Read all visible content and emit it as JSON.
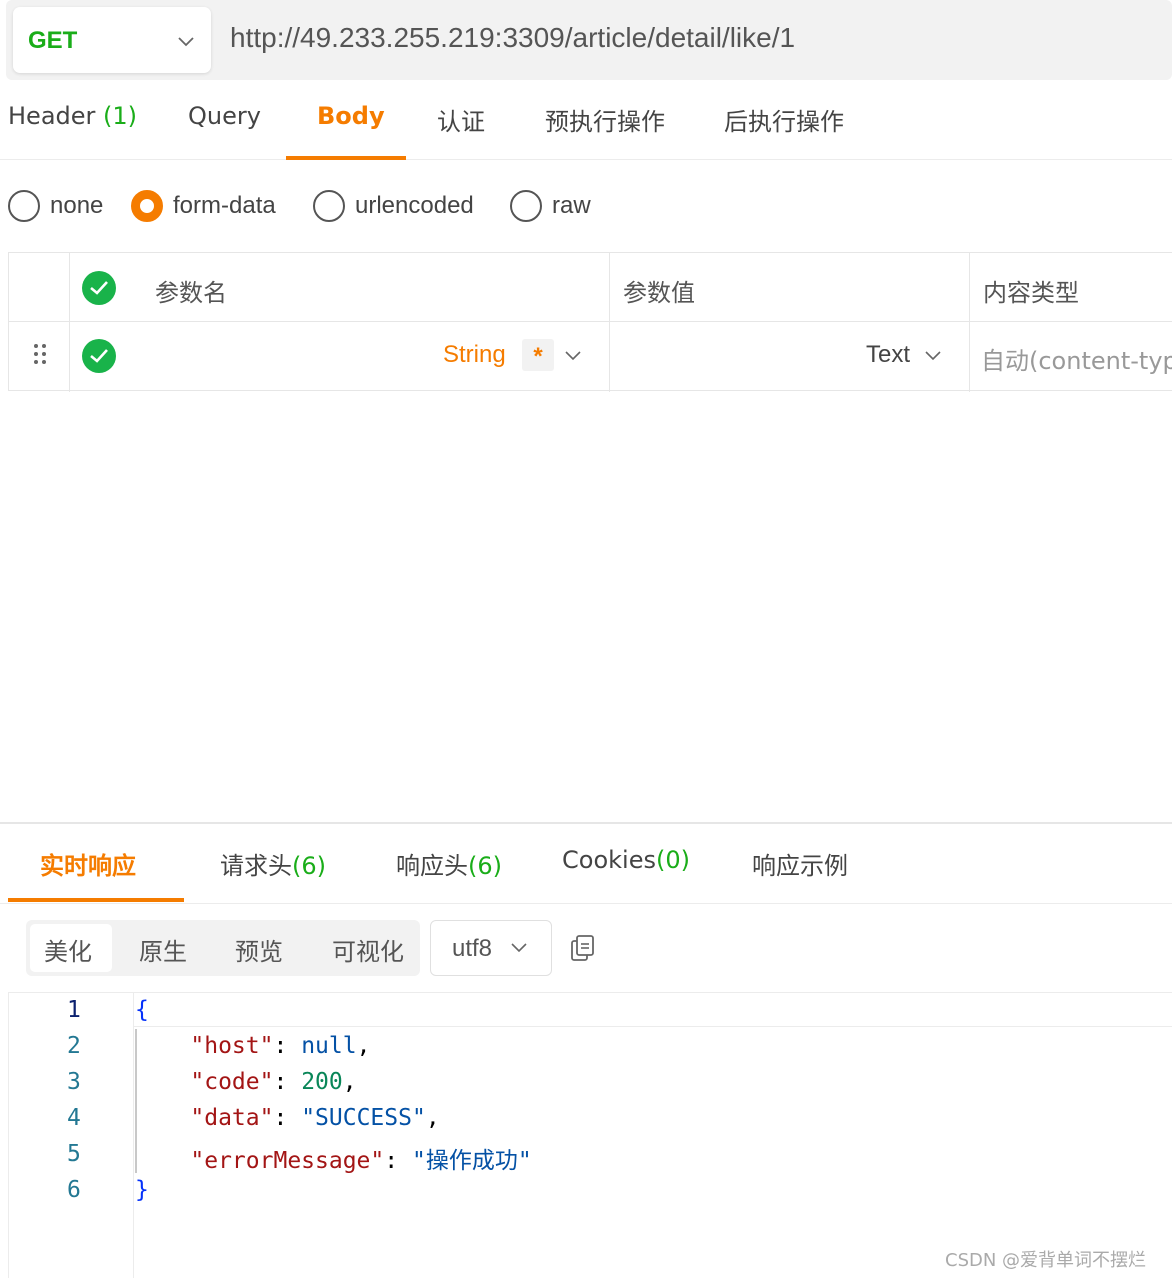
{
  "request": {
    "method": "GET",
    "url": "http://49.233.255.219:3309/article/detail/like/1"
  },
  "request_tabs": [
    {
      "label": "Header",
      "count": "(1)"
    },
    {
      "label": "Query"
    },
    {
      "label": "Body",
      "active": true
    },
    {
      "label": "认证"
    },
    {
      "label": "预执行操作"
    },
    {
      "label": "后执行操作"
    }
  ],
  "body_types": [
    {
      "label": "none",
      "checked": false
    },
    {
      "label": "form-data",
      "checked": true
    },
    {
      "label": "urlencoded",
      "checked": false
    },
    {
      "label": "raw",
      "checked": false
    }
  ],
  "params_table": {
    "headers": [
      "参数名",
      "参数值",
      "内容类型"
    ],
    "rows": [
      {
        "type": "String",
        "required_mark": "*",
        "value_type": "Text",
        "content_type": "自动(content-type)"
      }
    ]
  },
  "response_tabs": [
    {
      "label": "实时响应",
      "active": true
    },
    {
      "label": "请求头",
      "count": "(6)"
    },
    {
      "label": "响应头",
      "count": "(6)"
    },
    {
      "label": "Cookies",
      "count": "(0)"
    },
    {
      "label": "响应示例"
    }
  ],
  "view_modes": [
    "美化",
    "原生",
    "预览",
    "可视化"
  ],
  "encoding": "utf8",
  "response_body": {
    "line_numbers": [
      "1",
      "2",
      "3",
      "4",
      "5",
      "6"
    ],
    "open_brace": "{",
    "close_brace": "}",
    "fields": [
      {
        "key": "\"host\"",
        "value": "null",
        "comma": ","
      },
      {
        "key": "\"code\"",
        "value": "200",
        "comma": ","
      },
      {
        "key": "\"data\"",
        "value": "\"SUCCESS\"",
        "comma": ","
      },
      {
        "key": "\"errorMessage\"",
        "value": "\"操作成功\"",
        "comma": ""
      }
    ]
  },
  "watermark": "CSDN @爱背单词不摆烂",
  "colors": {
    "accent": "#f57c00",
    "method_green": "#1aad19",
    "check_green": "#19b34a"
  }
}
